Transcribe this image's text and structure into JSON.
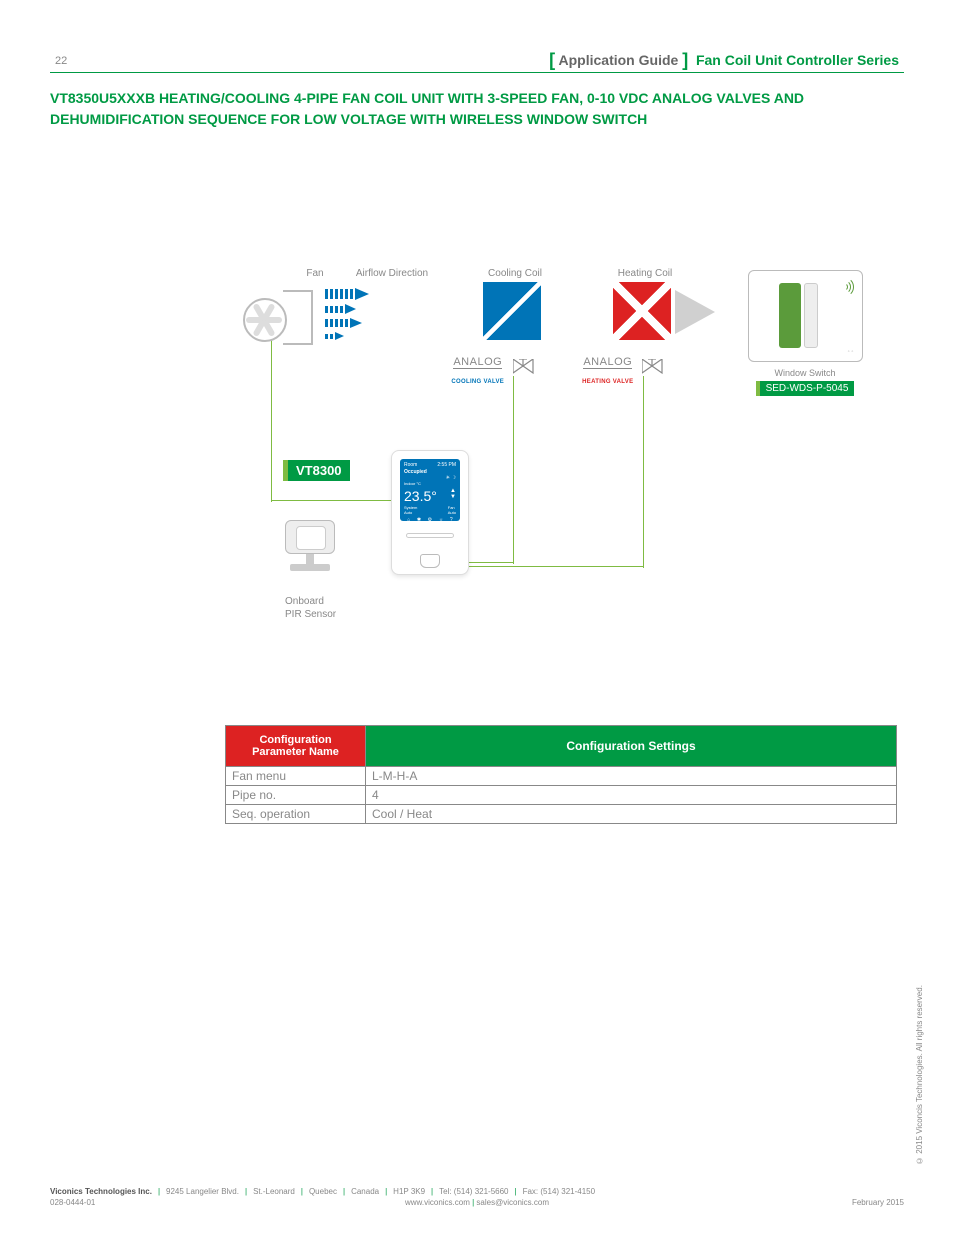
{
  "page_number": "22",
  "header": {
    "guide_label_open": "[",
    "guide_label": "Application Guide",
    "guide_label_close": "]",
    "series": "Fan Coil Unit Controller Series"
  },
  "title": "VT8350U5XXXB HEATING/COOLING 4-PIPE FAN COIL UNIT WITH 3-SPEED FAN,  0-10 VDC ANALOG VALVES AND DEHUMIDIFICATION SEQUENCE FOR LOW VOLTAGE WITH WIRELESS WINDOW SWITCH",
  "diagram": {
    "fan_label": "Fan",
    "airflow_label": "Airflow Direction",
    "cooling_label": "Cooling Coil",
    "heating_label": "Heating Coil",
    "analog_label": "ANALOG",
    "cooling_valve_sub": "COOLING VALVE",
    "heating_valve_sub": "HEATING VALVE",
    "window_switch_label": "Window Switch",
    "window_switch_model": "SED-WDS-P-5045",
    "controller_badge": "VT8300",
    "onboard_label_l1": "Onboard",
    "onboard_label_l2": "PIR Sensor",
    "thermostat": {
      "room": "Room",
      "time": "2:55 PM",
      "status": "Occupied",
      "indoor": "Indoor °C",
      "temp": "23.5°",
      "system": "System",
      "system_val": "Auto",
      "fan": "Fan",
      "fan_val": "Auto"
    }
  },
  "table": {
    "header_param": "Configuration Parameter Name",
    "header_settings": "Configuration Settings",
    "rows": [
      {
        "name": "Fan menu",
        "value": "L-M-H-A"
      },
      {
        "name": "Pipe no.",
        "value": "4"
      },
      {
        "name": "Seq. operation",
        "value": "Cool / Heat"
      }
    ]
  },
  "footer": {
    "company": "Viconics Technologies Inc.",
    "addr1": "9245 Langelier Blvd.",
    "addr2": "St.-Leonard",
    "addr3": "Quebec",
    "addr4": "Canada",
    "postal": "H1P 3K9",
    "tel": "Tel: (514) 321-5660",
    "fax": "Fax: (514) 321-4150",
    "doc_no": "028-0444-01",
    "web": "www.viconics.com",
    "email": "sales@viconics.com",
    "date": "February 2015",
    "copyright": "© 2015 Viconcis Technologies. All rights reserved."
  }
}
